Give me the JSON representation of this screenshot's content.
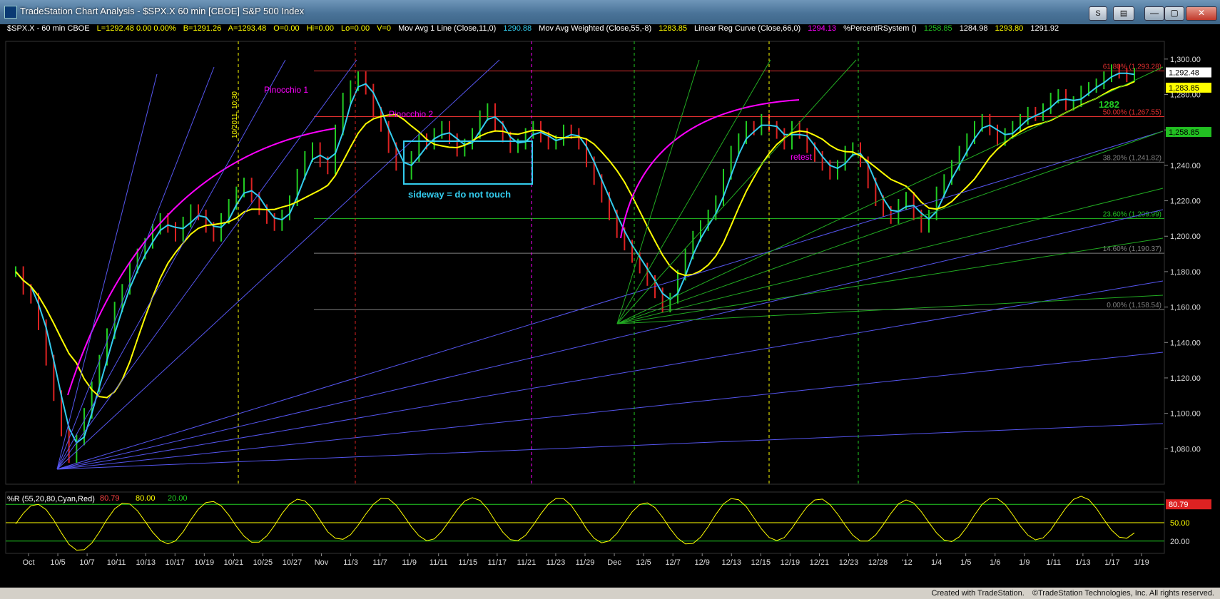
{
  "window": {
    "title": "TradeStation Chart Analysis - $SPX.X 60 min [CBOE] S&P 500 Index",
    "buttons": {
      "s_label": "S",
      "chart_label": "▤",
      "minimize_label": "—",
      "maximize_label": "▢",
      "close_label": "✕"
    }
  },
  "header": {
    "symbol": "$SPX.X - 60 min  CBOE",
    "last": "L=1292.48  0.00  0.00%",
    "bid": "B=1291.26",
    "ask": "A=1293.48",
    "open": "O=0.00",
    "high": "Hi=0.00",
    "low": "Lo=0.00",
    "volume": "V=0",
    "ma1": "Mov Avg 1 Line (Close,11,0)",
    "ma1_val": "1290.88",
    "ma2": "Mov Avg Weighted (Close,55,-8)",
    "ma2_val": "1283.85",
    "lrc": "Linear Reg Curve (Close,66,0)",
    "lrc_val": "1294.13",
    "prs": "%PercentRSystem ()",
    "prs_v1": "1258.85",
    "prs_v2": "1284.98",
    "prs_v3": "1293.80",
    "prs_v4": "1291.92"
  },
  "annotations": {
    "pinocchio1": "Pinocchio 1",
    "pinocchio2": "Pinocchio 2",
    "sideway": "sideway = do not touch",
    "retest": "retest",
    "date_marker": "10/2011, 10:30",
    "level_1282": "1282"
  },
  "fib_levels": [
    {
      "label": "61.80% (1,293.28)",
      "price": 1293.28,
      "color": "#e0302f"
    },
    {
      "label": "50.00% (1,267.55)",
      "price": 1267.55,
      "color": "#e0302f"
    },
    {
      "label": "38.20% (1,241.82)",
      "price": 1241.82,
      "color": "#808080"
    },
    {
      "label": "23.60% (1,209.99)",
      "price": 1209.99,
      "color": "#22c022"
    },
    {
      "label": "14.60% (1,190.37)",
      "price": 1190.37,
      "color": "#808080"
    },
    {
      "label": "0.00% (1,158.54)",
      "price": 1158.54,
      "color": "#808080"
    }
  ],
  "price_axis": {
    "ticks": [
      "1,300.00",
      "1,280.00",
      "1,260.00",
      "1,240.00",
      "1,220.00",
      "1,200.00",
      "1,180.00",
      "1,160.00",
      "1,140.00",
      "1,120.00",
      "1,100.00",
      "1,080.00"
    ],
    "last_flags": [
      {
        "text": "1,292.48",
        "price": 1292.48,
        "bg": "#ffffff",
        "fg": "#000000"
      },
      {
        "text": "1,283.85",
        "price": 1283.85,
        "bg": "#ffff00",
        "fg": "#000000"
      },
      {
        "text": "1,258.85",
        "price": 1258.85,
        "bg": "#22c022",
        "fg": "#000000"
      }
    ]
  },
  "time_axis": {
    "labels": [
      "Oct",
      "10/5",
      "10/7",
      "10/11",
      "10/13",
      "10/17",
      "10/19",
      "10/21",
      "10/25",
      "10/27",
      "Nov",
      "11/3",
      "11/7",
      "11/9",
      "11/11",
      "11/15",
      "11/17",
      "11/21",
      "11/23",
      "11/29",
      "Dec",
      "12/5",
      "12/7",
      "12/9",
      "12/13",
      "12/15",
      "12/19",
      "12/21",
      "12/23",
      "12/28",
      "'12",
      "1/4",
      "1/5",
      "1/6",
      "1/9",
      "1/11",
      "1/13",
      "1/17",
      "1/19"
    ]
  },
  "oscillator": {
    "title": "%R (55,20,80,Cyan,Red)",
    "value": "80.79",
    "level_high": "80.00",
    "level_low": "20.00",
    "badge": "80.79",
    "ticks": [
      "80.79",
      "50.00",
      "50.00",
      "20.00"
    ],
    "level_50": "50.00"
  },
  "status": {
    "created": "Created with TradeStation.",
    "copyright": "©TradeStation Technologies, Inc. All rights reserved."
  },
  "chart_data": {
    "type": "candlestick",
    "series": [
      {
        "name": "$SPX.X 60 min",
        "note": "price bars"
      },
      {
        "name": "Mov Avg 1 Line (Close,11,0)",
        "color": "#33ccee"
      },
      {
        "name": "Mov Avg Weighted (Close,55,-8)",
        "color": "#ffff00"
      },
      {
        "name": "Linear Reg Curve (Close,66,0)",
        "color": "#ff00ff"
      }
    ],
    "ylim": [
      1060,
      1310
    ],
    "closes": [
      1180,
      1170,
      1165,
      1150,
      1130,
      1110,
      1090,
      1075,
      1085,
      1100,
      1115,
      1130,
      1145,
      1160,
      1170,
      1182,
      1190,
      1196,
      1204,
      1210,
      1205,
      1200,
      1208,
      1215,
      1212,
      1205,
      1200,
      1210,
      1218,
      1225,
      1230,
      1222,
      1215,
      1210,
      1206,
      1212,
      1220,
      1235,
      1245,
      1250,
      1242,
      1238,
      1260,
      1278,
      1285,
      1290,
      1283,
      1270,
      1262,
      1250,
      1240,
      1235,
      1245,
      1255,
      1252,
      1258,
      1262,
      1255,
      1248,
      1252,
      1258,
      1268,
      1272,
      1262,
      1256,
      1250,
      1252,
      1258,
      1262,
      1256,
      1252,
      1254,
      1260,
      1258,
      1252,
      1242,
      1232,
      1222,
      1212,
      1202,
      1195,
      1188,
      1182,
      1175,
      1168,
      1160,
      1165,
      1178,
      1190,
      1200,
      1206,
      1212,
      1220,
      1235,
      1248,
      1255,
      1262,
      1260,
      1266,
      1262,
      1258,
      1252,
      1262,
      1258,
      1250,
      1245,
      1240,
      1235,
      1240,
      1248,
      1250,
      1242,
      1230,
      1220,
      1214,
      1210,
      1218,
      1222,
      1212,
      1205,
      1212,
      1225,
      1232,
      1240,
      1248,
      1255,
      1262,
      1266,
      1260,
      1254,
      1258,
      1262,
      1266,
      1270,
      1268,
      1272,
      1278,
      1280,
      1274,
      1276,
      1282,
      1284,
      1286,
      1290,
      1294,
      1292,
      1290,
      1292
    ]
  }
}
